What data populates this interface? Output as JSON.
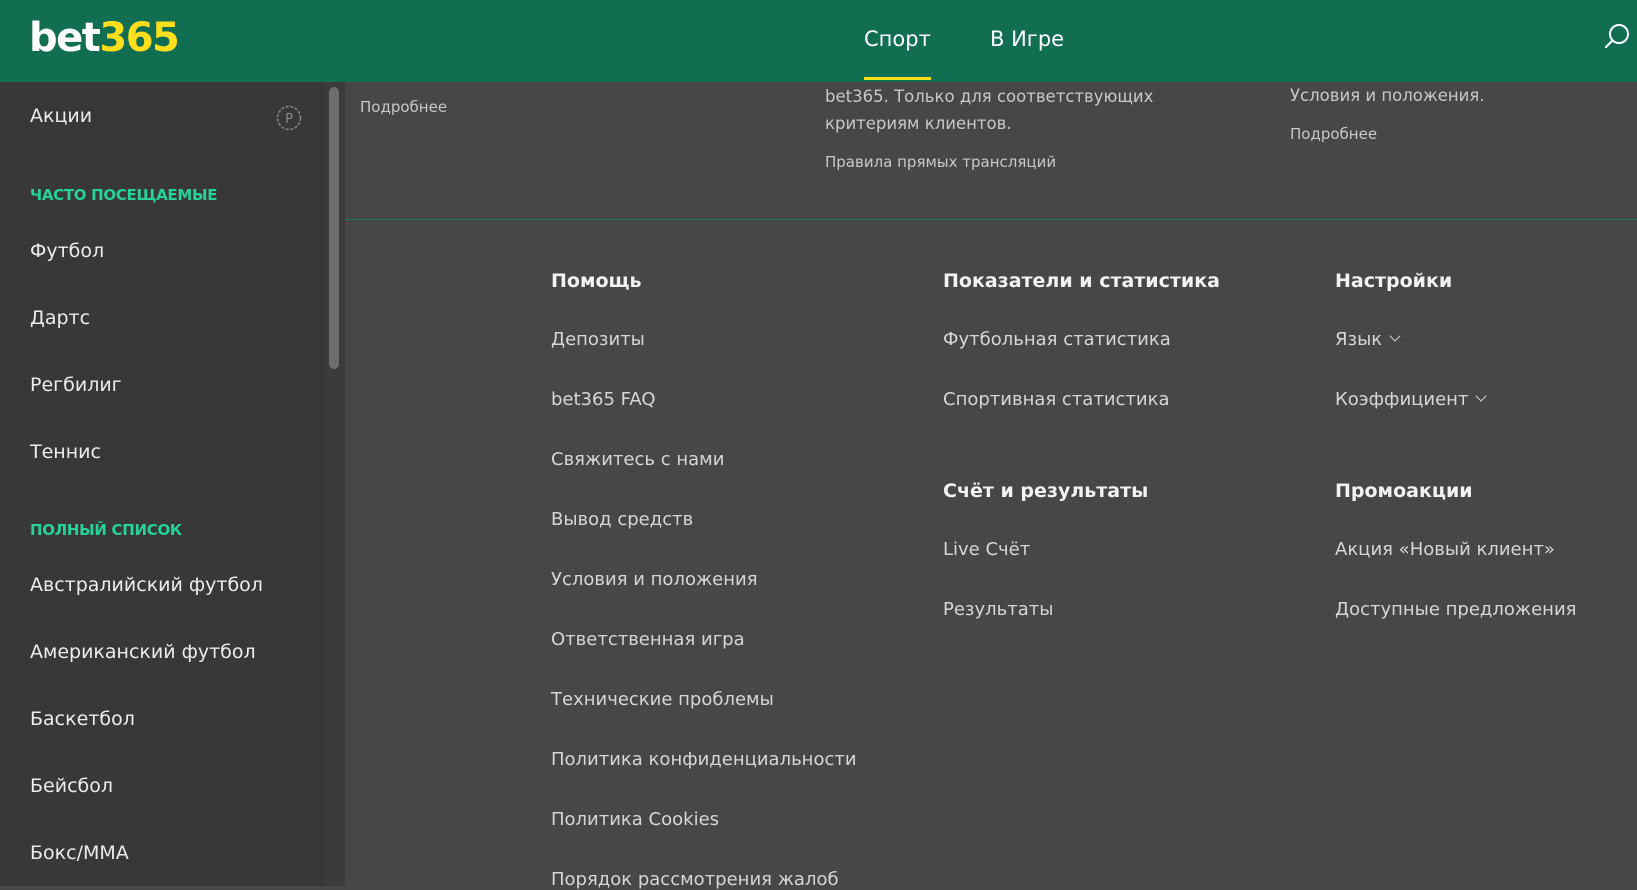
{
  "header": {
    "logo_part1": "bet",
    "logo_part2": "365",
    "tabs": [
      "Спорт",
      "В Игре"
    ],
    "active_tab": "Спорт",
    "search_icon": "search-icon"
  },
  "sidebar": {
    "promo_label": "Акции",
    "promo_icon": "promo-p-icon",
    "frequent_heading": "ЧАСТО ПОСЕЩАЕМЫЕ",
    "frequent_items": [
      "Футбол",
      "Дартс",
      "Регбилиг",
      "Теннис"
    ],
    "full_heading": "ПОЛНЫЙ СПИСОК",
    "full_items": [
      "Австралийский футбол",
      "Американский футбол",
      "Баскетбол",
      "Бейсбол",
      "Бокс/ММА"
    ]
  },
  "top_info": {
    "col1_link": "Подробнее",
    "col2_text": "bet365. Только для соответствующих критериям клиентов.",
    "col2_link": "Правила прямых трансляций",
    "col3_text": "Условия и положения.",
    "col3_link": "Подробнее"
  },
  "footer": {
    "help": {
      "title": "Помощь",
      "links": [
        "Депозиты",
        "bet365 FAQ",
        "Свяжитесь с нами",
        "Вывод средств",
        "Условия и положения",
        "Ответственная игра",
        "Технические проблемы",
        "Политика конфиденциальности",
        "Политика Cookies",
        "Порядок рассмотрения жалоб"
      ]
    },
    "stats": {
      "title": "Показатели и статистика",
      "links": [
        "Футбольная статистика",
        "Спортивная статистика"
      ]
    },
    "scores": {
      "title": "Счёт и результаты",
      "links": [
        "Live Счёт",
        "Результаты"
      ]
    },
    "settings": {
      "title": "Настройки",
      "language": "Язык",
      "odds": "Коэффициент"
    },
    "promos": {
      "title": "Промоакции",
      "links": [
        "Акция «Новый клиент»",
        "Доступные предложения"
      ]
    }
  },
  "colors": {
    "header_bg": "#126e51",
    "accent_yellow": "#ffdf1b",
    "section_green": "#27d19a",
    "sidebar_bg": "#383838",
    "main_bg": "#474747"
  }
}
